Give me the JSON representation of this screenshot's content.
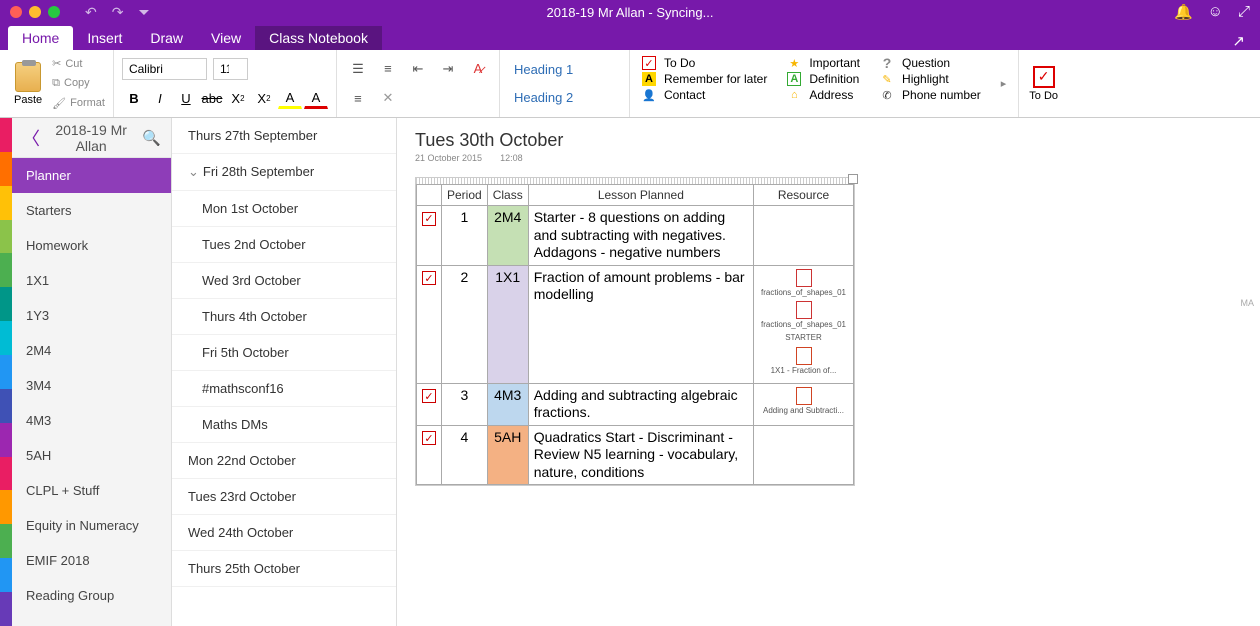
{
  "window": {
    "title": "2018-19 Mr Allan - Syncing..."
  },
  "menu": {
    "tabs": [
      "Home",
      "Insert",
      "Draw",
      "View",
      "Class Notebook"
    ],
    "active": "Home"
  },
  "ribbon": {
    "clipboard": {
      "paste": "Paste",
      "cut": "Cut",
      "copy": "Copy",
      "format": "Format"
    },
    "font": {
      "name": "Calibri",
      "size": "11"
    },
    "styles": {
      "h1": "Heading 1",
      "h2": "Heading 2"
    },
    "tags": {
      "col1": [
        {
          "icon": "check",
          "label": "To Do"
        },
        {
          "icon": "A",
          "label": "Remember for later"
        },
        {
          "icon": "contact",
          "label": "Contact"
        }
      ],
      "col2": [
        {
          "icon": "star",
          "label": "Important"
        },
        {
          "icon": "def",
          "label": "Definition"
        },
        {
          "icon": "addr",
          "label": "Address"
        }
      ],
      "col3": [
        {
          "icon": "q",
          "label": "Question"
        },
        {
          "icon": "hl",
          "label": "Highlight"
        },
        {
          "icon": "phone",
          "label": "Phone number"
        }
      ]
    },
    "todo": "To Do"
  },
  "nav": {
    "notebook": "2018-19 Mr Allan",
    "sections": [
      "Planner",
      "Starters",
      "Homework",
      "1X1",
      "1Y3",
      "2M4",
      "3M4",
      "4M3",
      "5AH",
      "CLPL + Stuff",
      "Equity in Numeracy",
      "EMIF 2018",
      "Reading Group"
    ],
    "activeSection": 0,
    "pages": [
      {
        "t": "Thurs 27th September",
        "sub": false
      },
      {
        "t": "Fri 28th September",
        "sub": false,
        "parent": true
      },
      {
        "t": "Mon 1st October",
        "sub": true
      },
      {
        "t": "Tues 2nd October",
        "sub": true
      },
      {
        "t": "Wed 3rd October",
        "sub": true
      },
      {
        "t": "Thurs 4th October",
        "sub": true
      },
      {
        "t": "Fri 5th October",
        "sub": true
      },
      {
        "t": "#mathsconf16",
        "sub": true
      },
      {
        "t": "Maths DMs",
        "sub": true
      },
      {
        "t": "Mon 22nd October",
        "sub": false
      },
      {
        "t": "Tues 23rd October",
        "sub": false
      },
      {
        "t": "Wed 24th October",
        "sub": false
      },
      {
        "t": "Thurs 25th October",
        "sub": false
      }
    ]
  },
  "page": {
    "title": "Tues 30th October",
    "date": "21 October 2015",
    "time": "12:08",
    "headers": {
      "period": "Period",
      "class": "Class",
      "lesson": "Lesson Planned",
      "resource": "Resource"
    },
    "rows": [
      {
        "period": "1",
        "class": "2M4",
        "clClass": "cl-2M4",
        "lesson": "Starter - 8 questions on adding and subtracting with negatives.\nAddagons - negative numbers",
        "resources": []
      },
      {
        "period": "2",
        "class": "1X1",
        "clClass": "cl-1X1",
        "lesson": "Fraction of amount problems - bar modelling",
        "resources": [
          {
            "type": "pdf",
            "name": "fractions_of_shapes_01"
          },
          {
            "type": "pdf",
            "name": "fractions_of_shapes_01"
          },
          {
            "type": "text",
            "name": "STARTER"
          },
          {
            "type": "ppt",
            "name": "1X1 - Fraction of..."
          }
        ]
      },
      {
        "period": "3",
        "class": "4M3",
        "clClass": "cl-4M3",
        "lesson": "Adding and subtracting algebraic fractions.",
        "resources": [
          {
            "type": "ppt",
            "name": "Adding and Subtracti..."
          }
        ]
      },
      {
        "period": "4",
        "class": "5AH",
        "clClass": "cl-5AH",
        "lesson": "Quadratics Start - Discriminant - Review N5 learning - vocabulary, nature, conditions",
        "resources": []
      }
    ],
    "sideTag": "MA"
  }
}
